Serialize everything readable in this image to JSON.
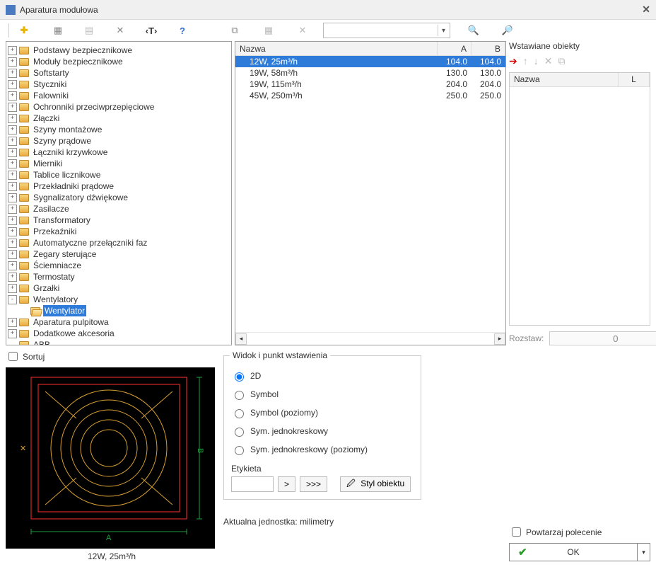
{
  "window": {
    "title": "Aparatura modułowa"
  },
  "toolbar": {
    "search_value": ""
  },
  "tree": {
    "items": [
      {
        "label": "Podstawy bezpiecznikowe",
        "exp": "+",
        "depth": 0
      },
      {
        "label": "Moduły bezpiecznikowe",
        "exp": "+",
        "depth": 0
      },
      {
        "label": "Softstarty",
        "exp": "+",
        "depth": 0
      },
      {
        "label": "Styczniki",
        "exp": "+",
        "depth": 0
      },
      {
        "label": "Falowniki",
        "exp": "+",
        "depth": 0
      },
      {
        "label": "Ochronniki przeciwprzepięciowe",
        "exp": "+",
        "depth": 0
      },
      {
        "label": "Złączki",
        "exp": "+",
        "depth": 0
      },
      {
        "label": "Szyny montażowe",
        "exp": "+",
        "depth": 0
      },
      {
        "label": "Szyny prądowe",
        "exp": "+",
        "depth": 0
      },
      {
        "label": "Łączniki krzywkowe",
        "exp": "+",
        "depth": 0
      },
      {
        "label": "Mierniki",
        "exp": "+",
        "depth": 0
      },
      {
        "label": "Tablice licznikowe",
        "exp": "+",
        "depth": 0
      },
      {
        "label": "Przekładniki prądowe",
        "exp": "+",
        "depth": 0
      },
      {
        "label": "Sygnalizatory dźwiękowe",
        "exp": "+",
        "depth": 0
      },
      {
        "label": "Zasilacze",
        "exp": "+",
        "depth": 0
      },
      {
        "label": "Transformatory",
        "exp": "+",
        "depth": 0
      },
      {
        "label": "Przekaźniki",
        "exp": "+",
        "depth": 0
      },
      {
        "label": "Automatyczne przełączniki faz",
        "exp": "+",
        "depth": 0
      },
      {
        "label": "Zegary sterujące",
        "exp": "+",
        "depth": 0
      },
      {
        "label": "Ściemniacze",
        "exp": "+",
        "depth": 0
      },
      {
        "label": "Termostaty",
        "exp": "+",
        "depth": 0
      },
      {
        "label": "Grzałki",
        "exp": "+",
        "depth": 0
      },
      {
        "label": "Wentylatory",
        "exp": "-",
        "depth": 0
      },
      {
        "label": "Wentylator",
        "exp": "",
        "depth": 1,
        "selected": true,
        "open": true
      },
      {
        "label": "Aparatura pulpitowa",
        "exp": "+",
        "depth": 0
      },
      {
        "label": "Dodatkowe akcesoria",
        "exp": "+",
        "depth": 0
      },
      {
        "label": "ABB",
        "exp": "",
        "depth": 0
      }
    ]
  },
  "list": {
    "columns": {
      "name": "Nazwa",
      "a": "A",
      "b": "B"
    },
    "rows": [
      {
        "name": "12W, 25m³/h",
        "a": "104.0",
        "b": "104.0",
        "selected": true
      },
      {
        "name": "19W, 58m³/h",
        "a": "130.0",
        "b": "130.0"
      },
      {
        "name": "19W, 115m³/h",
        "a": "204.0",
        "b": "204.0"
      },
      {
        "name": "45W, 250m³/h",
        "a": "250.0",
        "b": "250.0"
      }
    ]
  },
  "inserted": {
    "title": "Wstawiane obiekty",
    "columns": {
      "name": "Nazwa",
      "l": "L"
    }
  },
  "rozstaw": {
    "label": "Rozstaw:",
    "value": "0"
  },
  "sortuj_label": "Sortuj",
  "preview_label": "12W, 25m³/h",
  "view_group": {
    "title": "Widok i punkt wstawienia",
    "options": [
      "2D",
      "Symbol",
      "Symbol (poziomy)",
      "Sym. jednokreskowy",
      "Sym. jednokreskowy (poziomy)"
    ],
    "selected": 0,
    "etykieta_label": "Etykieta",
    "etykieta_value": "",
    "btn_gt": ">",
    "btn_gtgt": ">>>",
    "btn_styl": "Styl obiektu"
  },
  "unit_text": "Aktualna jednostka: milimetry",
  "powtarzaj_label": "Powtarzaj polecenie",
  "ok_label": "OK"
}
